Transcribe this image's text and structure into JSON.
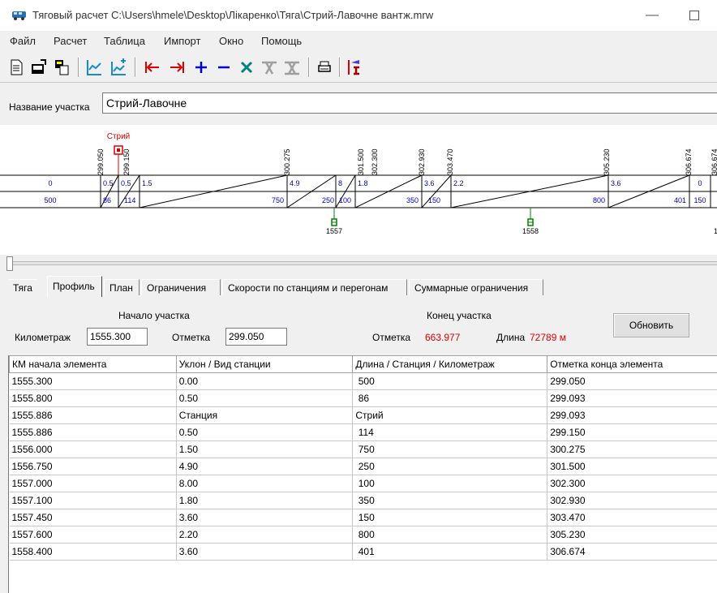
{
  "window": {
    "title": "Тяговый расчет   C:\\Users\\hmele\\Desktop\\Лікаренко\\Тяга\\Стрий-Лавочне вантж.mrw",
    "minimize_glyph": "—"
  },
  "menu": [
    "Файл",
    "Расчет",
    "Таблица",
    "Импорт",
    "Окно",
    "Помощь"
  ],
  "toolbar": {
    "icons": [
      "new-document-icon",
      "open-icon",
      "properties-icon",
      "profile-chart-icon",
      "add-profile-icon",
      "go-first-icon",
      "go-last-icon",
      "add-icon",
      "remove-icon",
      "delete-icon",
      "clear-icon",
      "clear-all-icon",
      "print-icon",
      "train-calc-icon"
    ]
  },
  "section": {
    "label": "Название участка",
    "value": "Стрий-Лавочне"
  },
  "profile_graph": {
    "station_name": "Стрий",
    "marks": [
      "299.050",
      "299.150",
      "300.275",
      "301.500",
      "302.300",
      "302.930",
      "303.470",
      "305.230",
      "306.674",
      "306.674"
    ],
    "grades": [
      "0",
      "0.5",
      "0.5",
      "1.5",
      "4.9",
      "8",
      "1.8",
      "3.6",
      "2.2",
      "3.6",
      "0"
    ],
    "lengths": [
      "500",
      "86",
      "114",
      "750",
      "250",
      "100",
      "350",
      "150",
      "800",
      "401",
      "150"
    ],
    "km_posts": [
      "1557",
      "1558",
      "1"
    ]
  },
  "tabs": [
    "Тяга",
    "Профиль",
    "План",
    "Ограничения",
    "Скорости по станциям и перегонам",
    "Суммарные ограничения"
  ],
  "active_tab": "Профиль",
  "form": {
    "start_caption": "Начало участка",
    "end_caption": "Конец участка",
    "km_label": "Километраж",
    "km_value": "1555.300",
    "elev_label": "Отметка",
    "elev_value": "299.050",
    "end_elev_label": "Отметка",
    "end_elev_value": "663.977",
    "length_label": "Длина",
    "length_value": "72789 м",
    "refresh_label": "Обновить"
  },
  "table": {
    "columns": [
      "КМ начала элемента",
      "Уклон / Вид станции",
      "Длина / Станция / Километраж",
      "Отметка конца элемента"
    ],
    "rows": [
      [
        "1555.300",
        "0.00",
        " 500",
        "299.050"
      ],
      [
        "1555.800",
        "0.50",
        " 86",
        "299.093"
      ],
      [
        "1555.886",
        "Станция",
        "Стрий",
        "299.093"
      ],
      [
        "1555.886",
        "0.50",
        " 114",
        "299.150"
      ],
      [
        "1556.000",
        "1.50",
        " 750",
        "300.275"
      ],
      [
        "1556.750",
        "4.90",
        " 250",
        "301.500"
      ],
      [
        "1557.000",
        "8.00",
        " 100",
        "302.300"
      ],
      [
        "1557.100",
        "1.80",
        " 350",
        "302.930"
      ],
      [
        "1557.450",
        "3.60",
        " 150",
        "303.470"
      ],
      [
        "1557.600",
        "2.20",
        " 800",
        "305.230"
      ],
      [
        "1558.400",
        "3.60",
        " 401",
        "306.674"
      ]
    ]
  }
}
